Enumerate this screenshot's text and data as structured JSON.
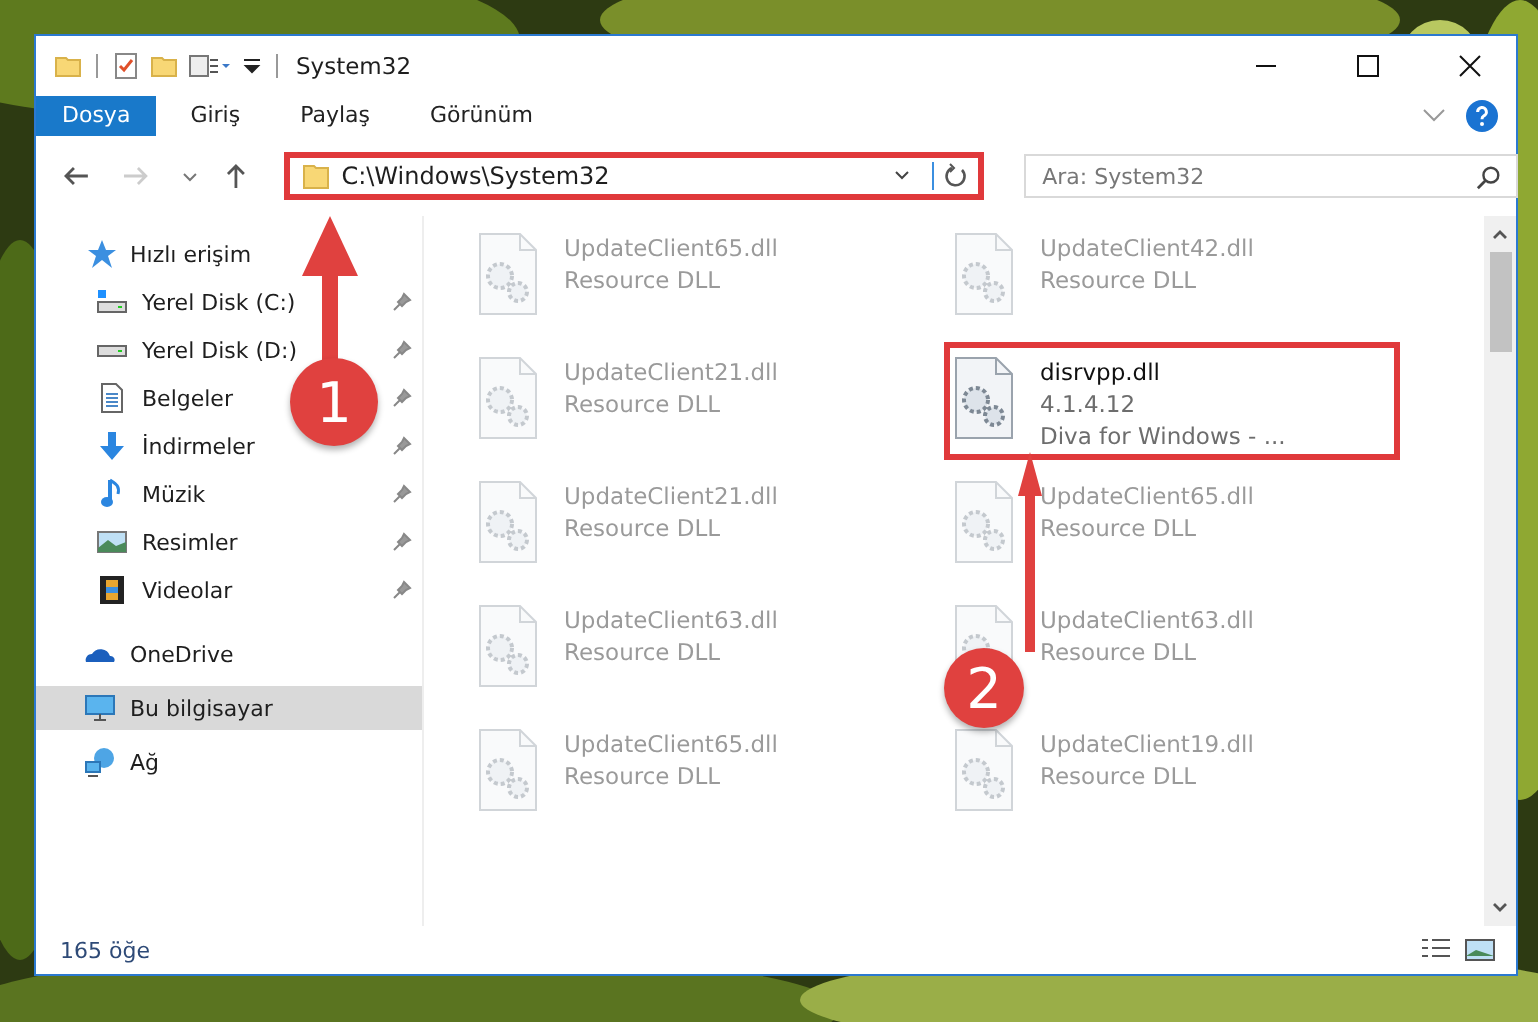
{
  "window": {
    "title": "System32"
  },
  "ribbon_tabs": [
    {
      "label": "Dosya",
      "selected": true
    },
    {
      "label": "Giriş",
      "selected": false
    },
    {
      "label": "Paylaş",
      "selected": false
    },
    {
      "label": "Görünüm",
      "selected": false
    }
  ],
  "address": {
    "path": "C:\\Windows\\System32"
  },
  "search": {
    "placeholder": "Ara: System32"
  },
  "sidebar": {
    "items": [
      {
        "label": "Hızlı erişim",
        "selected": false,
        "children": [
          {
            "label": "Yerel Disk (C:)",
            "selected": false,
            "pinned": true
          },
          {
            "label": "Yerel Disk (D:)",
            "selected": false,
            "pinned": true
          },
          {
            "label": "Belgeler",
            "selected": false,
            "pinned": true
          },
          {
            "label": "İndirmeler",
            "selected": false,
            "pinned": true
          },
          {
            "label": "Müzik",
            "selected": false,
            "pinned": true
          },
          {
            "label": "Resimler",
            "selected": false,
            "pinned": true
          },
          {
            "label": "Videolar",
            "selected": false,
            "pinned": true
          }
        ]
      },
      {
        "label": "OneDrive",
        "selected": false
      },
      {
        "label": "Bu bilgisayar",
        "selected": true
      },
      {
        "label": "Ağ",
        "selected": false
      }
    ]
  },
  "files": [
    {
      "name": "UpdateClient65.dll",
      "details": [
        "Resource DLL"
      ],
      "blurred": true
    },
    {
      "name": "UpdateClient42.dll",
      "details": [
        "Resource DLL"
      ],
      "blurred": true
    },
    {
      "name": "UpdateClient21.dll",
      "details": [
        "Resource DLL"
      ],
      "blurred": true
    },
    {
      "name": "disrvpp.dll",
      "details": [
        "4.1.4.12",
        "Diva for Windows - ..."
      ],
      "blurred": false
    },
    {
      "name": "UpdateClient21.dll",
      "details": [
        "Resource DLL"
      ],
      "blurred": true
    },
    {
      "name": "UpdateClient65.dll",
      "details": [
        "Resource DLL"
      ],
      "blurred": true
    },
    {
      "name": "UpdateClient63.dll",
      "details": [
        "Resource DLL"
      ],
      "blurred": true
    },
    {
      "name": "UpdateClient63.dll",
      "details": [
        "Resource DLL"
      ],
      "blurred": true
    },
    {
      "name": "UpdateClient65.dll",
      "details": [
        "Resource DLL"
      ],
      "blurred": true
    },
    {
      "name": "UpdateClient19.dll",
      "details": [
        "Resource DLL"
      ],
      "blurred": true
    }
  ],
  "status_bar": {
    "item_count": "165 öğe"
  },
  "annotations": [
    {
      "label": "1"
    },
    {
      "label": "2"
    }
  ]
}
